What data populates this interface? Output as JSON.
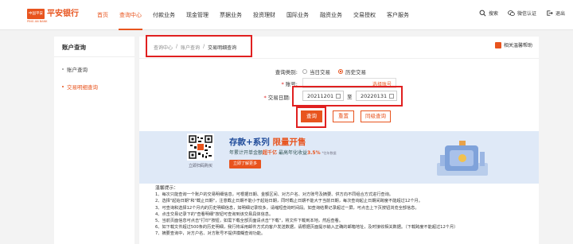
{
  "brand": {
    "mark": "中国平安 PINGAN",
    "name": "平安银行",
    "sub": "PING AN BANK"
  },
  "nav": [
    {
      "label": "首页",
      "state": "active"
    },
    {
      "label": "查询中心",
      "state": "current"
    },
    {
      "label": "付款业务",
      "state": ""
    },
    {
      "label": "现金管理",
      "state": ""
    },
    {
      "label": "票据业务",
      "state": ""
    },
    {
      "label": "投资理财",
      "state": ""
    },
    {
      "label": "国际业务",
      "state": ""
    },
    {
      "label": "融资业务",
      "state": ""
    },
    {
      "label": "交易授权",
      "state": ""
    },
    {
      "label": "客户服务",
      "state": ""
    }
  ],
  "tools": {
    "search": "搜索",
    "wechat": "微信认证",
    "logout": "退出"
  },
  "sidebar": {
    "title": "账户查询",
    "items": [
      {
        "label": "账户查询"
      },
      {
        "label": "交易明细查询"
      }
    ]
  },
  "breadcrumb": {
    "items": [
      "查询中心",
      "账户查询",
      "交易明细查询"
    ],
    "sep": "/"
  },
  "help": "相关温馨帮助",
  "form": {
    "query_type_label": "查询类别:",
    "query_type_options": [
      "当日交易",
      "历史交易"
    ],
    "account_label": "账号:",
    "account_link": "选择账号",
    "date_label": "交易日期:",
    "date_from": "20211201",
    "date_sep": "至",
    "date_to": "20220131",
    "btn_query": "查询",
    "btn_reset": "重置",
    "btn_sync": "同级查询"
  },
  "banner": {
    "title_main": "存款+系列",
    "title_accent": "限量开售",
    "sub_pre": "年累计开单金额",
    "sub_hot1": "超千亿",
    "sub_mid": "最高年化收益",
    "sub_hot2": "3.5%",
    "sub_post": "*往年数据",
    "button": "立即了解更多",
    "qr_caption": "立即扫码购买"
  },
  "tips": {
    "title": "温馨提示：",
    "items": [
      "1、每次只能查询一个账户的交易明细信息，可根据日期、金额区间、对方户名、对方账号及摘要、供方向不同组合方式进行查询。",
      "2、选择\"起始日期\"和\"截止日期\"，注意截止日期不能小于起始日期，同时截止日期不能大于当前日期，每次查询起止日期间跨度不能超过12个月。",
      "3、可查询和选择12个月内的历史明细信息，如明细记录较多，请缩短查询时间段。如查询结果记录超过一屏，可点击上下页按钮浏览全部信息。",
      "4、点击交易记录下的\"查看明细\"按钮可查询到该交易具体信息。",
      "5、当前页面信息可点击\"打印\"按钮，如需下载全部页面请点击\"下载\"，将文件下载到本地，然后查看。",
      "6、如下载文件超过500条的历史明细，我行将采用邮件方式向客户发送数据，请根据页面提示输入正确的邮箱地址，及时接收相关数据。（下载跨度不能超过12个月）",
      "7、摘要查询中，对方户名、对方账号不提供模糊查询功能。"
    ]
  },
  "colors": {
    "brand": "#e8541e",
    "highlight": "#e02020",
    "banner_bg": "#dfe9f7",
    "banner_title": "#1f4b9a"
  }
}
